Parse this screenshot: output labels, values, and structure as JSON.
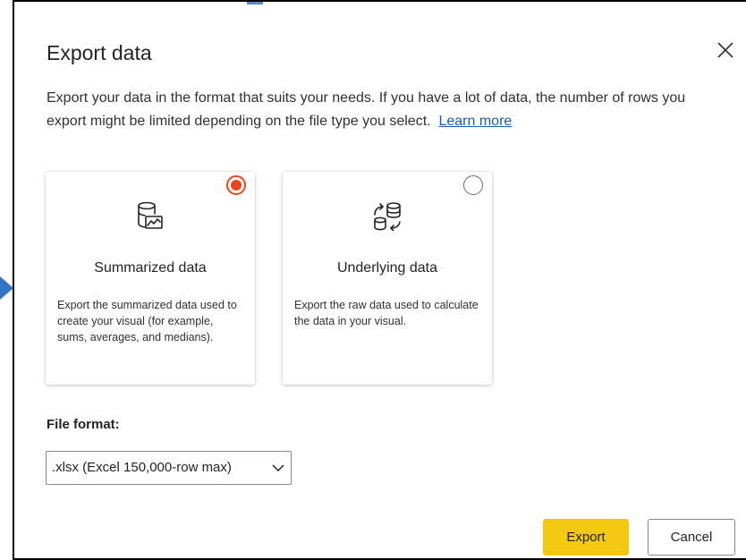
{
  "dialog": {
    "title": "Export data",
    "description": "Export your data in the format that suits your needs. If you have a lot of data, the number of rows you export might be limited depending on the file type you select.",
    "learn_more": "Learn more",
    "close_icon": "close-icon"
  },
  "options": [
    {
      "title": "Summarized data",
      "description": "Export the summarized data used to create your visual (for example, sums, averages, and medians).",
      "selected": true,
      "icon": "database-chart-icon"
    },
    {
      "title": "Underlying data",
      "description": "Export the raw data used to calculate the data in your visual.",
      "selected": false,
      "icon": "database-sync-icon"
    }
  ],
  "file_format": {
    "label": "File format:",
    "selected": ".xlsx (Excel 150,000-row max)"
  },
  "buttons": {
    "export": "Export",
    "cancel": "Cancel"
  },
  "colors": {
    "accent_radio": "#e8461e",
    "export_button": "#f2c811",
    "link": "#1a5cb5",
    "pointer": "#3574c4"
  }
}
